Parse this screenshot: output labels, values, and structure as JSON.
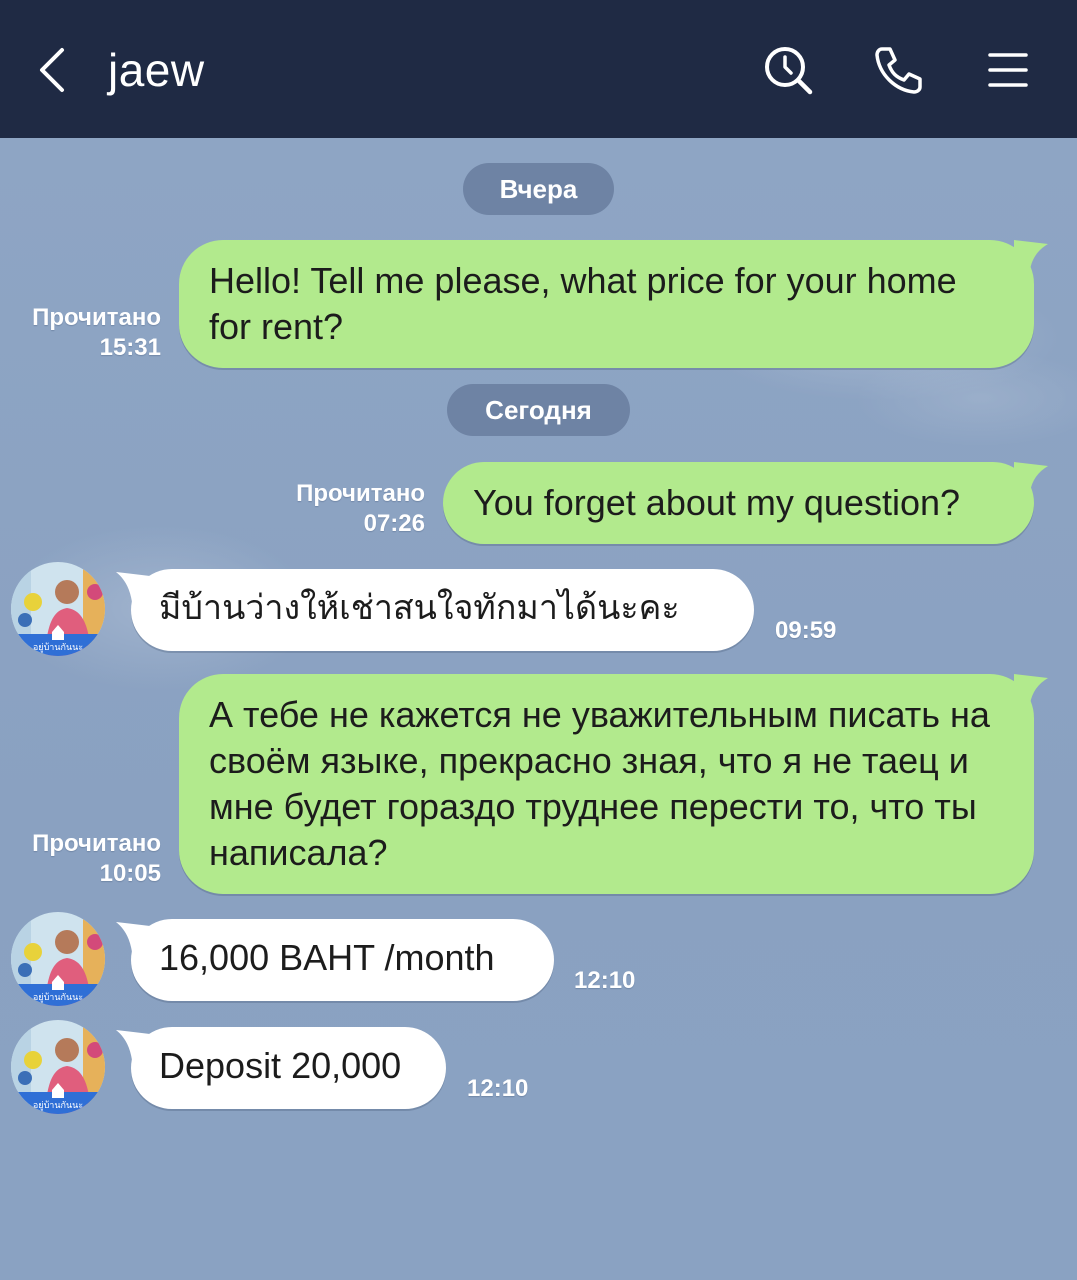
{
  "header": {
    "title": "jaew",
    "icons": [
      "back-arrow-icon",
      "search-icon",
      "phone-icon",
      "menu-icon"
    ],
    "bg_color": "#1f2a44"
  },
  "dates": {
    "yesterday": "Вчера",
    "today": "Сегодня"
  },
  "messages": [
    {
      "direction": "out",
      "text": "Hello! Tell me please, what price for your home for rent?",
      "status": "Прочитано",
      "time": "15:31"
    },
    {
      "direction": "out",
      "text": "You forget about my question?",
      "status": "Прочитано",
      "time": "07:26"
    },
    {
      "direction": "in",
      "text": "มีบ้านว่างให้เช่าสนใจทักมาได้นะคะ",
      "time": "09:59"
    },
    {
      "direction": "out",
      "text": "А тебе не кажется не уважительным писать на своём языке, прекрасно зная, что я не таец и мне будет гораздо труднее перести то, что ты написала?",
      "status": "Прочитано",
      "time": "10:05"
    },
    {
      "direction": "in",
      "text": "16,000 BAHT /month",
      "time": "12:10"
    },
    {
      "direction": "in",
      "text": "Deposit 20,000",
      "time": "12:10"
    }
  ],
  "avatar": {
    "caption": "อยู่บ้านกันนะ"
  },
  "colors": {
    "outgoing_bubble": "#b2ea8d",
    "incoming_bubble": "#ffffff",
    "chat_background": "#8aa1c1",
    "date_pill": "#6e83a4"
  }
}
